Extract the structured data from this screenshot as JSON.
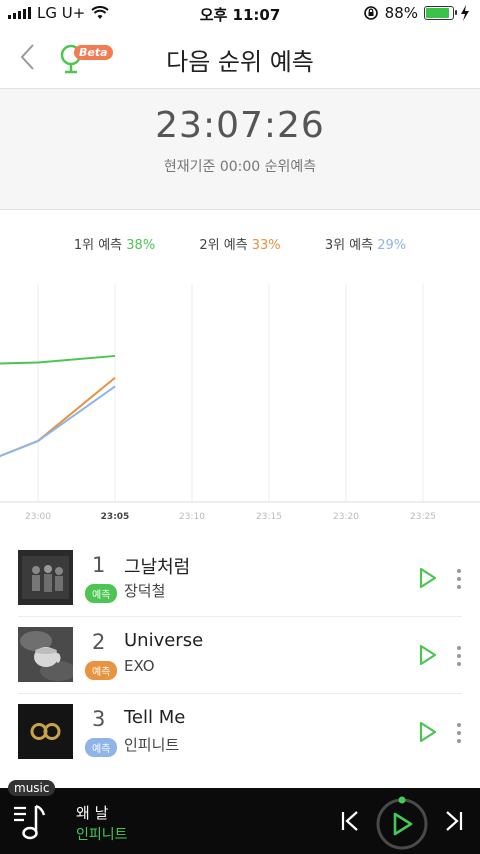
{
  "status": {
    "carrier": "LG U+",
    "time": "오후 11:07",
    "battery": "88%",
    "battery_level": 0.88
  },
  "header": {
    "title": "다음 순위 예측",
    "beta_label": "Beta"
  },
  "timer": {
    "clock": "23:07:26",
    "subtitle": "현재기준 00:00 순위예측"
  },
  "legend": [
    {
      "label": "1위 예측",
      "value": "38%",
      "color": "#4cc552"
    },
    {
      "label": "2위 예측",
      "value": "33%",
      "color": "#e8933f"
    },
    {
      "label": "3위 예측",
      "value": "29%",
      "color": "#8fb4e8"
    }
  ],
  "chart_data": {
    "type": "line",
    "x": [
      "22:55",
      "23:00",
      "23:05"
    ],
    "tick_labels": [
      "23:00",
      "23:05",
      "23:10",
      "23:15",
      "23:20",
      "23:25"
    ],
    "active_tick": "23:05",
    "series": [
      {
        "name": "1위",
        "color": "#4cc552",
        "values": [
          0.63,
          0.64,
          0.67
        ]
      },
      {
        "name": "2위",
        "color": "#e8933f",
        "values": [
          0.14,
          0.28,
          0.57
        ]
      },
      {
        "name": "3위",
        "color": "#8fb4e8",
        "values": [
          0.14,
          0.28,
          0.53
        ]
      }
    ],
    "ylim": [
      0,
      1
    ],
    "grid": true
  },
  "songs": [
    {
      "rank": "1",
      "title": "그날처럼",
      "tag": "예측",
      "tag_color": "#4cc552",
      "artist": "장덕철"
    },
    {
      "rank": "2",
      "title": "Universe",
      "tag": "예측",
      "tag_color": "#e8933f",
      "artist": "EXO"
    },
    {
      "rank": "3",
      "title": "Tell Me",
      "tag": "예측",
      "tag_color": "#8fb4e8",
      "artist": "인피니트"
    }
  ],
  "player": {
    "badge": "music",
    "title": "왜 날",
    "artist": "인피니트"
  }
}
